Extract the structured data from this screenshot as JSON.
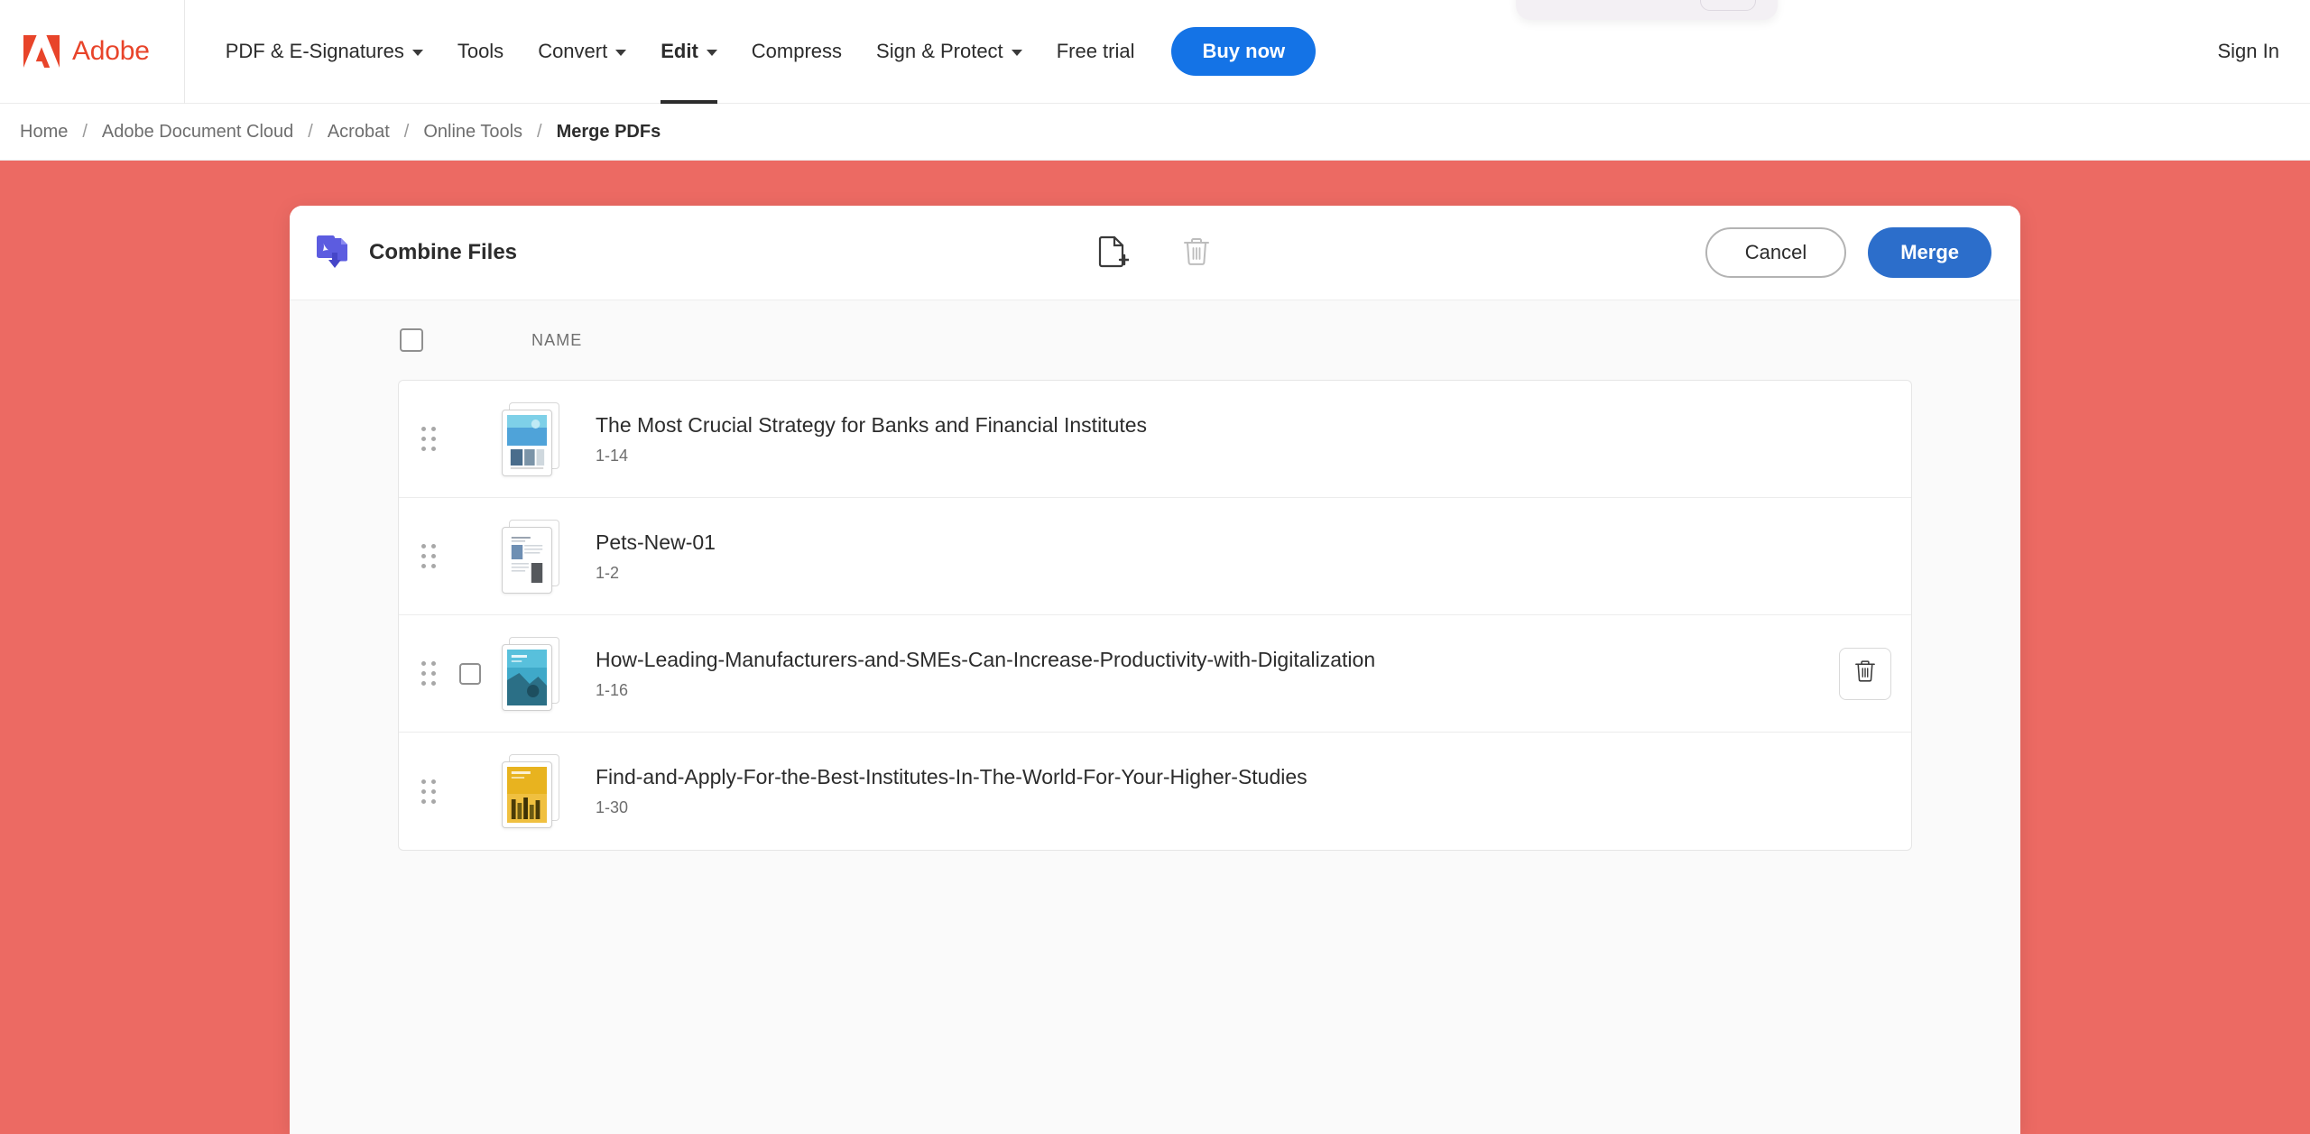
{
  "nav": {
    "brand": {
      "name": "Adobe",
      "logo_icon": "adobe-logo-icon"
    },
    "items": [
      {
        "label": "PDF & E-Signatures",
        "has_dropdown": true,
        "active": false
      },
      {
        "label": "Tools",
        "has_dropdown": false,
        "active": false
      },
      {
        "label": "Convert",
        "has_dropdown": true,
        "active": false
      },
      {
        "label": "Edit",
        "has_dropdown": true,
        "active": true
      },
      {
        "label": "Compress",
        "has_dropdown": false,
        "active": false
      },
      {
        "label": "Sign & Protect",
        "has_dropdown": true,
        "active": false
      },
      {
        "label": "Free trial",
        "has_dropdown": false,
        "active": false
      }
    ],
    "buy_now_label": "Buy now",
    "sign_in_label": "Sign In",
    "accent_blue": "#1473E6",
    "brand_red": "#E8442A"
  },
  "breadcrumb": {
    "separator": "/",
    "items": [
      {
        "label": "Home",
        "current": false
      },
      {
        "label": "Adobe Document Cloud",
        "current": false
      },
      {
        "label": "Acrobat",
        "current": false
      },
      {
        "label": "Online Tools",
        "current": false
      },
      {
        "label": "Merge PDFs",
        "current": true
      }
    ]
  },
  "page": {
    "background_color": "#EC6A63"
  },
  "panel": {
    "title": "Combine Files",
    "title_icon": "combine-files-icon",
    "tools": [
      {
        "name": "add-file-icon",
        "enabled": true
      },
      {
        "name": "delete-icon",
        "enabled": false
      }
    ],
    "cancel_label": "Cancel",
    "merge_label": "Merge",
    "merge_color": "#2C6ECB",
    "column_header_name": "NAME",
    "select_all_checked": false,
    "rows": [
      {
        "name": "The Most Crucial Strategy for Banks and Financial Institutes",
        "pages": "1-14",
        "thumb_color": "#4FA3D9",
        "thumb_accent": "#7ED0E8",
        "checkbox_visible": false,
        "delete_visible": false
      },
      {
        "name": "Pets-New-01",
        "pages": "1-2",
        "thumb_color": "#cfcfcf",
        "thumb_accent": "#8aa8c4",
        "checkbox_visible": false,
        "delete_visible": false
      },
      {
        "name": "How-Leading-Manufacturers-and-SMEs-Can-Increase-Productivity-with-Digitalization",
        "pages": "1-16",
        "thumb_color": "#3FA9C9",
        "thumb_accent": "#2b6f86",
        "checkbox_visible": true,
        "delete_visible": true
      },
      {
        "name": "Find-and-Apply-For-the-Best-Institutes-In-The-World-For-Your-Higher-Studies",
        "pages": "1-30",
        "thumb_color": "#E8B31F",
        "thumb_accent": "#6b5a12",
        "checkbox_visible": false,
        "delete_visible": false
      }
    ]
  }
}
